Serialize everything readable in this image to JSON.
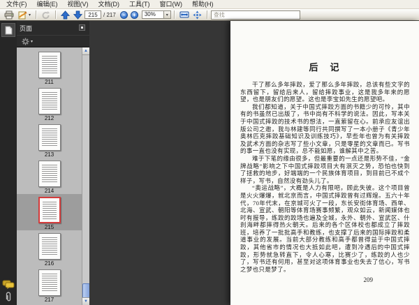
{
  "menu": {
    "items": [
      "文件(F)",
      "编辑(E)",
      "视图(V)",
      "文档(D)",
      "工具(T)",
      "窗口(W)",
      "帮助(H)"
    ]
  },
  "toolbar": {
    "page_current": "215",
    "page_total": "/ 217",
    "zoom_value": "30%",
    "search_placeholder": "查找",
    "icons": {
      "caret_down": "▾",
      "scroll_up": "▲",
      "scroll_down": "▼",
      "zoom_out": "−",
      "zoom_in": "+"
    }
  },
  "sidebar": {
    "panel_title": "页面",
    "thumbnails": [
      {
        "page": "211",
        "selected": false
      },
      {
        "page": "212",
        "selected": false
      },
      {
        "page": "213",
        "selected": false
      },
      {
        "page": "214",
        "selected": false
      },
      {
        "page": "215",
        "selected": true
      },
      {
        "page": "216",
        "selected": false
      },
      {
        "page": "217",
        "selected": false
      }
    ]
  },
  "document": {
    "title": "后　记",
    "paragraphs": [
      "干了那么多年摔跤，爱了那么多年摔跤，总该有些文字的东西留下，留给后来人，留给摔跤事业，这是我多年来的愿望，也是朋友们的愿望。这也是李宝如先生的愿望吧。",
      "我们都知道，关于中国式摔跤方面的书籍少的可怜，其中有的书虽然已出版了，书中尚有不科学的说法。因此，写本关于中国式摔跤的技术书的想法，一直萦留在心。前承应友谊出版公司之邀，我与林建等同行共同撰写了一本小册子《青少年奥林匹克摔跤基础知识及训练技巧》，早些年也曾为有关摔跤及武术方面的杂志写了些小文章，只是零星的文章而已。写书的事一直也没有实现，总不能如愿，谁解其中之苦。",
      "难于下笔的缘由很多，但最重要的一点还是形势不佳，“金牌战略”影响之下中国式摔跤项目大有泯灭之势，恐怕也快到了拯救的地步，好端端的一个民族体育项目，到目前已不成个样子，写书，自然没有劲头儿了。",
      "“奥运战略”，大概是人力有限吧，顾此失彼。这个项目曾是火火爆爆，就北京而言，中国式摔跤曾有过辉煌。五六十年代，70年代末，在京城可火了一段，东长安街体育场、西单、北海、宣武、朝阳等体育场赛事频繁，观众如云，新闻媒体也时有报导，练跤的跤场也遍及全城，永外、朝外、宣武区、什刹海畔都摔得热火朝天。后来的各个区体校也都成立了摔跤班，培养了一批批高手和教练，也支撑了后来的国际摔跤和柔道事业的发展。当前大部分教练和高手都曾得益于中国式摔跤，其他省市的情况也大抵如此吧，遭到冷遇后的中国式摔跤，形势就急转直下，令人心寒，比赛少了，练跤的人也少了，写书还有何用，甚至对这项体育事业也失去了信心，写书之梦也只是梦了。"
    ],
    "page_number": "209"
  },
  "colors": {
    "selection_red": "#d43c3c",
    "arrow_blue": "#2e6ecb",
    "chrome_bg": "#ece9e0",
    "panel_dark": "#2b2b2b",
    "list_bg": "#bcbcbc",
    "doc_bg": "#363636",
    "comment_yellow": "#e3bc37"
  }
}
